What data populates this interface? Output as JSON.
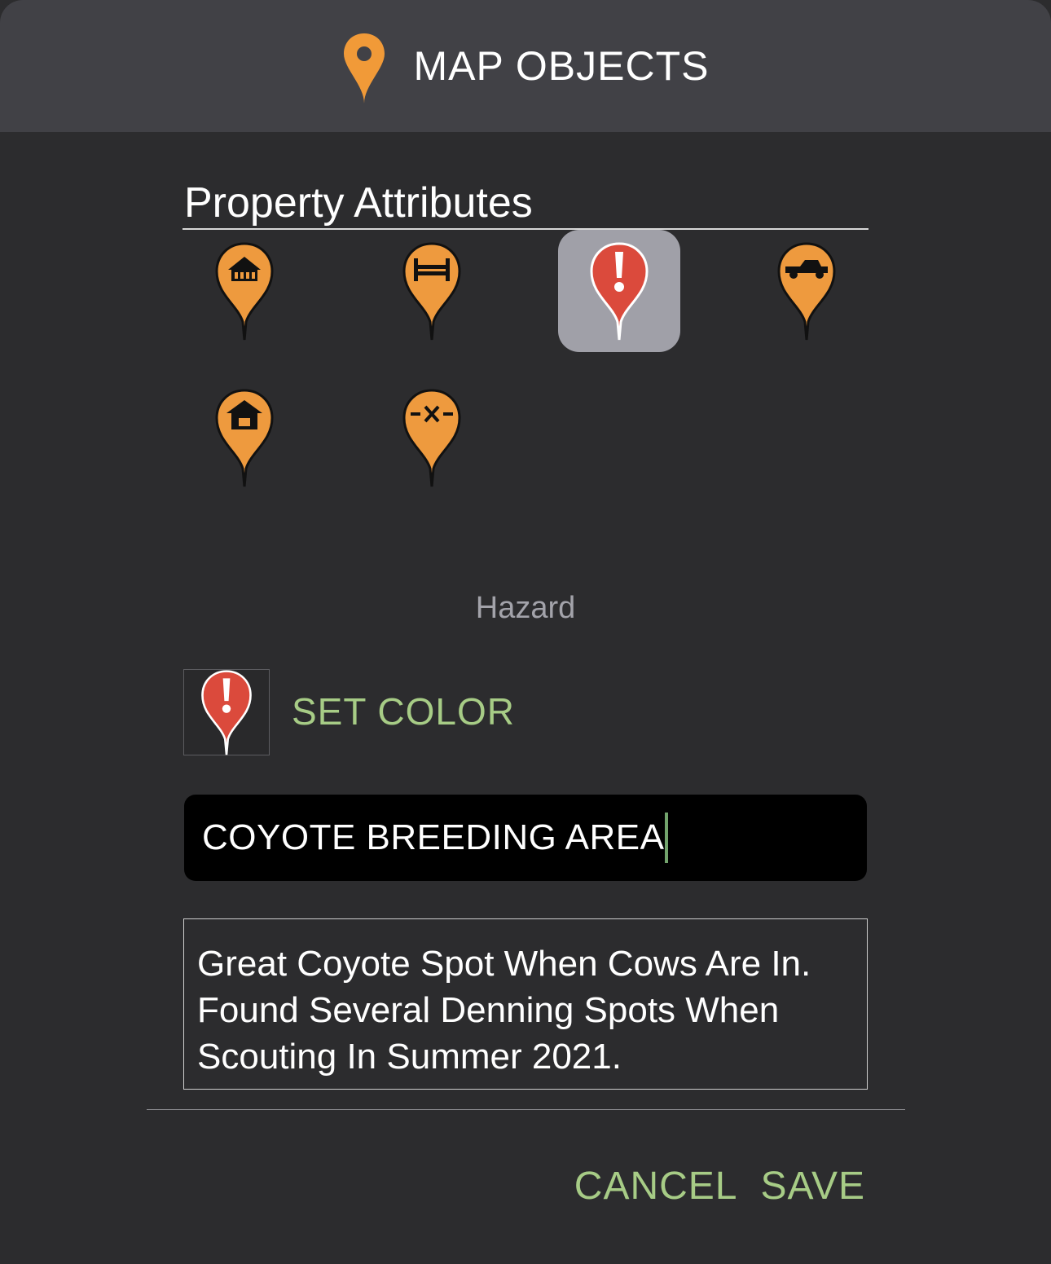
{
  "header": {
    "icon": "location-pin-icon",
    "title": "MAP OBJECTS",
    "accent": "#f19a38"
  },
  "section": {
    "title": "Property Attributes"
  },
  "markers": [
    {
      "name": "cabin-marker-icon",
      "selected": false,
      "color": "#ee9a3e"
    },
    {
      "name": "bed-marker-icon",
      "selected": false,
      "color": "#ee9a3e"
    },
    {
      "name": "hazard-marker-icon",
      "selected": true,
      "color": "#db4a3c"
    },
    {
      "name": "truck-marker-icon",
      "selected": false,
      "color": "#ee9a3e"
    },
    {
      "name": "house-marker-icon",
      "selected": false,
      "color": "#ee9a3e"
    },
    {
      "name": "fence-marker-icon",
      "selected": false,
      "color": "#ee9a3e"
    }
  ],
  "selected_label": "Hazard",
  "color_picker": {
    "swatch_icon": "hazard-marker-icon",
    "label": "SET COLOR",
    "accent": "#a7cc86"
  },
  "name_field": {
    "value": "COYOTE BREEDING AREA"
  },
  "notes": {
    "value": "Great Coyote Spot When Cows Are In. Found Several Denning Spots When Scouting In Summer 2021."
  },
  "actions": {
    "cancel": "CANCEL",
    "save": "SAVE"
  }
}
